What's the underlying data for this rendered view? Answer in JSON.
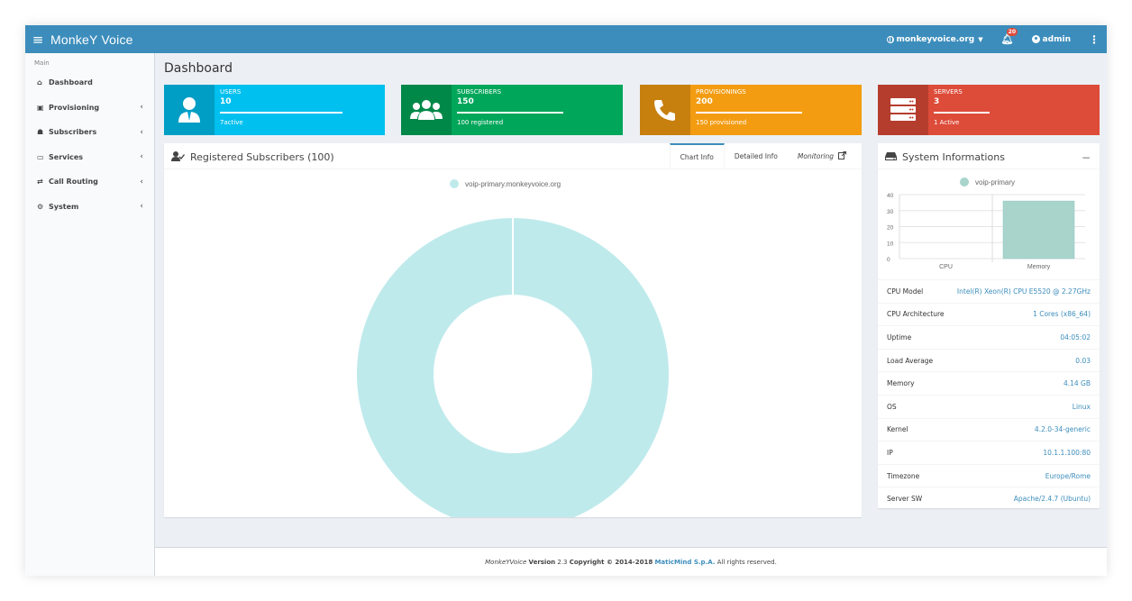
{
  "app": {
    "title": "MonkeY Voice"
  },
  "topbar": {
    "domain": "monkeyvoice.org",
    "notifications": "20",
    "user": "admin"
  },
  "sidebar": {
    "header": "Main",
    "items": [
      {
        "label": "Dashboard",
        "icon": "home-icon"
      },
      {
        "label": "Provisioning",
        "icon": "briefcase-icon"
      },
      {
        "label": "Subscribers",
        "icon": "users-icon"
      },
      {
        "label": "Services",
        "icon": "monitor-icon"
      },
      {
        "label": "Call Routing",
        "icon": "exchange-icon"
      },
      {
        "label": "System",
        "icon": "gears-icon"
      }
    ]
  },
  "page": {
    "title": "Dashboard"
  },
  "info_boxes": [
    {
      "label": "USERS",
      "value": "10",
      "desc": "7active",
      "color": "#00c0ef",
      "progress": 0.7
    },
    {
      "label": "SUBSCRIBERS",
      "value": "150",
      "desc": "100 registered",
      "color": "#00a65a",
      "progress": 0.67
    },
    {
      "label": "PROVISIONINGS",
      "value": "200",
      "desc": "150 provisioned",
      "color": "#f39c12",
      "progress": 0.75
    },
    {
      "label": "SERVERS",
      "value": "3",
      "desc": "1 Active",
      "color": "#dd4b39",
      "progress": 0.33
    }
  ],
  "subscribers_panel": {
    "title": "Registered Subscribers (100)",
    "tabs": [
      "Chart Info",
      "Detailed Info",
      "Monitoring"
    ],
    "chart_data": {
      "type": "pie",
      "labels": [
        "voip-primary.monkeyvoice.org"
      ],
      "values": [
        100
      ],
      "colors": [
        "#bfeaec"
      ],
      "legend": "top"
    }
  },
  "system_panel": {
    "title": "System Informations",
    "collapse": "−",
    "chart_data": {
      "type": "bar",
      "categories": [
        "CPU",
        "Memory"
      ],
      "series": [
        {
          "name": "voip-primary",
          "values": [
            0,
            36
          ]
        }
      ],
      "ylim": [
        0,
        40
      ],
      "yticks": [
        "40",
        "30",
        "20",
        "10",
        "0"
      ],
      "legend": "top",
      "color": "#a8d4cc"
    },
    "rows": [
      {
        "k": "CPU Model",
        "v": "Intel(R) Xeon(R) CPU E5520 @ 2.27GHz"
      },
      {
        "k": "CPU Architecture",
        "v": "1 Cores (x86_64)"
      },
      {
        "k": "Uptime",
        "v": "04:05:02"
      },
      {
        "k": "Load Average",
        "v": "0.03"
      },
      {
        "k": "Memory",
        "v": "4.14 GB"
      },
      {
        "k": "OS",
        "v": "Linux"
      },
      {
        "k": "Kernel",
        "v": "4.2.0-34-generic"
      },
      {
        "k": "IP",
        "v": "10.1.1.100:80"
      },
      {
        "k": "Timezone",
        "v": "Europe/Rome"
      },
      {
        "k": "Server SW",
        "v": "Apache/2.4.7 (Ubuntu)"
      }
    ]
  },
  "footer": {
    "product": "MonkeYVoice",
    "version_label": "Version",
    "version": "2.3",
    "copyright": "Copyright © 2014-2018",
    "company": "MaticMind S.p.A.",
    "rights": "All rights reserved."
  }
}
